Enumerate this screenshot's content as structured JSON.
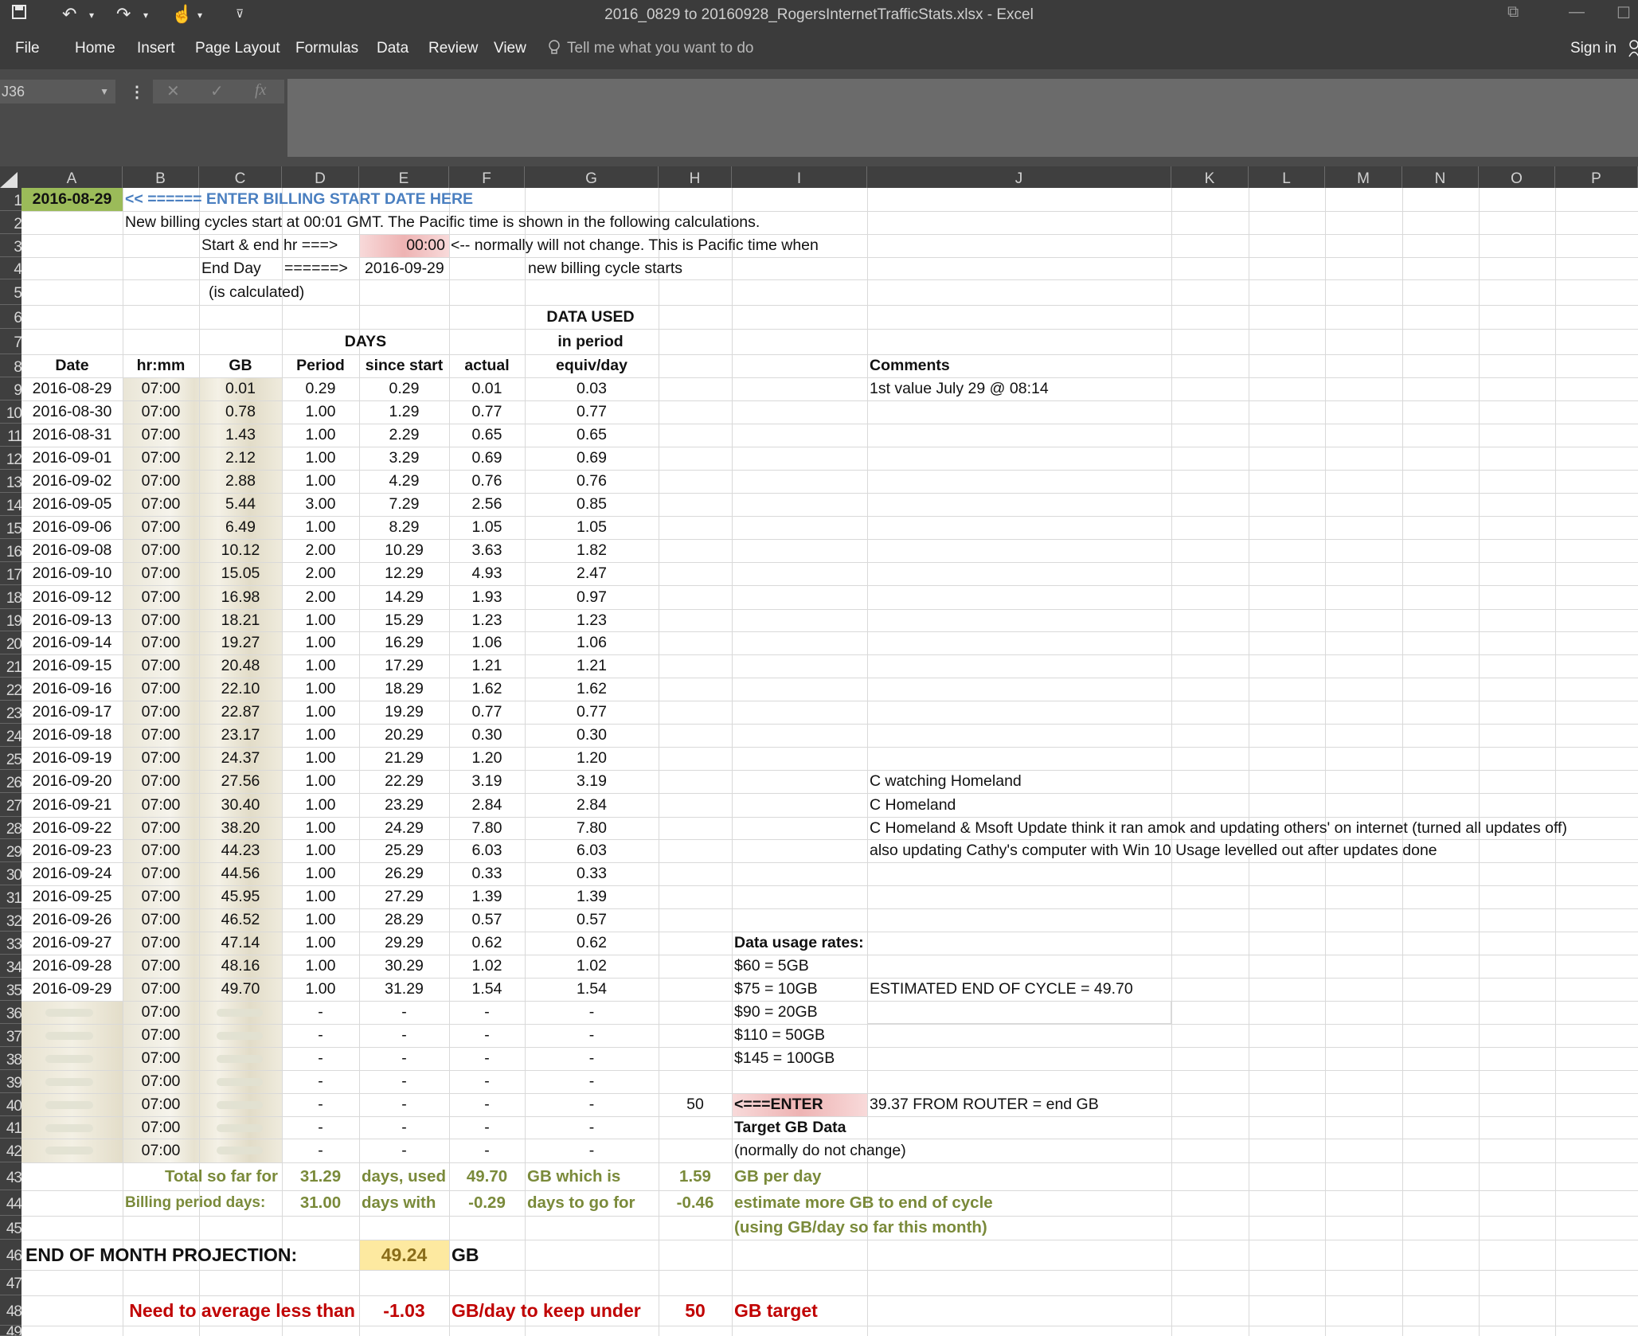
{
  "app": {
    "window_title": "2016_0829 to 20160928_RogersInternetTrafficStats.xlsx - Excel",
    "sign_in": "Sign in",
    "tabs": [
      "File",
      "Home",
      "Insert",
      "Page Layout",
      "Formulas",
      "Data",
      "Review",
      "View"
    ],
    "tell_me": "Tell me what you want to do"
  },
  "formula_bar": {
    "name_box": "J36",
    "fx_label": "fx",
    "cancel": "✕",
    "enter": "✓"
  },
  "columns": [
    "A",
    "B",
    "C",
    "D",
    "E",
    "F",
    "G",
    "H",
    "I",
    "J",
    "K",
    "L",
    "M",
    "N",
    "O",
    "P"
  ],
  "rows": [
    "1",
    "2",
    "3",
    "4",
    "5",
    "6",
    "7",
    "8",
    "9",
    "10",
    "11",
    "12",
    "13",
    "14",
    "15",
    "16",
    "17",
    "18",
    "19",
    "20",
    "21",
    "22",
    "23",
    "24",
    "25",
    "26",
    "27",
    "28",
    "29",
    "30",
    "31",
    "32",
    "33",
    "34",
    "35",
    "36",
    "37",
    "38",
    "39",
    "40",
    "41",
    "42",
    "43",
    "44",
    "45",
    "46",
    "47",
    "48",
    "49"
  ],
  "header_block": {
    "start_date": "2016-08-29",
    "enter_note": "<< ====== ENTER BILLING START DATE HERE",
    "cycle_note": "New billing cycles start at 00:01 GMT.  The Pacific time is shown in the following calculations.",
    "start_end_label": "Start & end hr ===>",
    "start_end_value": "00:00",
    "start_end_note": "<-- normally will not change. This is Pacific time when",
    "end_day_label": "End Day",
    "end_day_arrow": "======>",
    "end_day_value": "2016-09-29",
    "new_cycle_note": "new billing cycle starts",
    "calculated_note": "(is calculated)",
    "data_used": "DATA USED",
    "days": "DAYS",
    "in_period": "in period"
  },
  "table_headers": {
    "date": "Date",
    "hrmm": "hr:mm",
    "gb": "GB",
    "period": "Period",
    "since_start": "since start",
    "actual": "actual",
    "equiv": "equiv/day",
    "comments": "Comments"
  },
  "data_rows": [
    [
      "2016-08-29",
      "07:00",
      "0.01",
      "0.29",
      "0.29",
      "0.01",
      "0.03"
    ],
    [
      "2016-08-30",
      "07:00",
      "0.78",
      "1.00",
      "1.29",
      "0.77",
      "0.77"
    ],
    [
      "2016-08-31",
      "07:00",
      "1.43",
      "1.00",
      "2.29",
      "0.65",
      "0.65"
    ],
    [
      "2016-09-01",
      "07:00",
      "2.12",
      "1.00",
      "3.29",
      "0.69",
      "0.69"
    ],
    [
      "2016-09-02",
      "07:00",
      "2.88",
      "1.00",
      "4.29",
      "0.76",
      "0.76"
    ],
    [
      "2016-09-05",
      "07:00",
      "5.44",
      "3.00",
      "7.29",
      "2.56",
      "0.85"
    ],
    [
      "2016-09-06",
      "07:00",
      "6.49",
      "1.00",
      "8.29",
      "1.05",
      "1.05"
    ],
    [
      "2016-09-08",
      "07:00",
      "10.12",
      "2.00",
      "10.29",
      "3.63",
      "1.82"
    ],
    [
      "2016-09-10",
      "07:00",
      "15.05",
      "2.00",
      "12.29",
      "4.93",
      "2.47"
    ],
    [
      "2016-09-12",
      "07:00",
      "16.98",
      "2.00",
      "14.29",
      "1.93",
      "0.97"
    ],
    [
      "2016-09-13",
      "07:00",
      "18.21",
      "1.00",
      "15.29",
      "1.23",
      "1.23"
    ],
    [
      "2016-09-14",
      "07:00",
      "19.27",
      "1.00",
      "16.29",
      "1.06",
      "1.06"
    ],
    [
      "2016-09-15",
      "07:00",
      "20.48",
      "1.00",
      "17.29",
      "1.21",
      "1.21"
    ],
    [
      "2016-09-16",
      "07:00",
      "22.10",
      "1.00",
      "18.29",
      "1.62",
      "1.62"
    ],
    [
      "2016-09-17",
      "07:00",
      "22.87",
      "1.00",
      "19.29",
      "0.77",
      "0.77"
    ],
    [
      "2016-09-18",
      "07:00",
      "23.17",
      "1.00",
      "20.29",
      "0.30",
      "0.30"
    ],
    [
      "2016-09-19",
      "07:00",
      "24.37",
      "1.00",
      "21.29",
      "1.20",
      "1.20"
    ],
    [
      "2016-09-20",
      "07:00",
      "27.56",
      "1.00",
      "22.29",
      "3.19",
      "3.19"
    ],
    [
      "2016-09-21",
      "07:00",
      "30.40",
      "1.00",
      "23.29",
      "2.84",
      "2.84"
    ],
    [
      "2016-09-22",
      "07:00",
      "38.20",
      "1.00",
      "24.29",
      "7.80",
      "7.80"
    ],
    [
      "2016-09-23",
      "07:00",
      "44.23",
      "1.00",
      "25.29",
      "6.03",
      "6.03"
    ],
    [
      "2016-09-24",
      "07:00",
      "44.56",
      "1.00",
      "26.29",
      "0.33",
      "0.33"
    ],
    [
      "2016-09-25",
      "07:00",
      "45.95",
      "1.00",
      "27.29",
      "1.39",
      "1.39"
    ],
    [
      "2016-09-26",
      "07:00",
      "46.52",
      "1.00",
      "28.29",
      "0.57",
      "0.57"
    ],
    [
      "2016-09-27",
      "07:00",
      "47.14",
      "1.00",
      "29.29",
      "0.62",
      "0.62"
    ],
    [
      "2016-09-28",
      "07:00",
      "48.16",
      "1.00",
      "30.29",
      "1.02",
      "1.02"
    ],
    [
      "2016-09-29",
      "07:00",
      "49.70",
      "1.00",
      "31.29",
      "1.54",
      "1.54"
    ],
    [
      "",
      "07:00",
      "",
      "-",
      "-",
      "-",
      "-"
    ],
    [
      "",
      "07:00",
      "",
      "-",
      "-",
      "-",
      "-"
    ],
    [
      "",
      "07:00",
      "",
      "-",
      "-",
      "-",
      "-"
    ],
    [
      "",
      "07:00",
      "",
      "-",
      "-",
      "-",
      "-"
    ],
    [
      "",
      "07:00",
      "",
      "-",
      "-",
      "-",
      "-"
    ],
    [
      "",
      "07:00",
      "",
      "-",
      "-",
      "-",
      "-"
    ],
    [
      "",
      "07:00",
      "",
      "-",
      "-",
      "-",
      "-"
    ]
  ],
  "comments": [
    {
      "row": 9,
      "text": "1st value July 29 @ 08:14"
    },
    {
      "row": 26,
      "text": "C watching Homeland"
    },
    {
      "row": 27,
      "text": "C Homeland"
    },
    {
      "row": 28,
      "text": "C Homeland & Msoft Update think it ran amok and updating others' on internet (turned all updates off)"
    },
    {
      "row": 29,
      "text": "also updating Cathy's computer with Win 10 Usage levelled out after updates done"
    },
    {
      "row": 35,
      "text": "ESTIMATED END OF CYCLE = 49.70"
    },
    {
      "row": 40,
      "text": "39.37 FROM ROUTER = end GB"
    }
  ],
  "rates": {
    "title": "Data usage rates:",
    "items": [
      "$60 = 5GB",
      "$75 = 10GB",
      "$90 = 20GB",
      "$110 = 50GB",
      "$145 = 100GB"
    ],
    "target_value": "50",
    "enter_label": "<===ENTER",
    "target_label": "Target GB Data",
    "normally": "(normally do not change)"
  },
  "summary": {
    "total_label": "Total so far for",
    "total_days": "31.29",
    "days_used": "days, used",
    "total_gb": "49.70",
    "gb_which_is": "GB   which is",
    "gb_per_day_value": "1.59",
    "gb_per_day": "GB per day",
    "billing_label": "Billing period days:",
    "billing_days": "31.00",
    "days_with": "days with",
    "days_to_go_value": "-0.29",
    "days_to_go": "days to go for",
    "more_gb_value": "-0.46",
    "more_gb_label": "estimate more GB to end of cycle",
    "using_note": "(using GB/day so far this month)",
    "projection_label": "END OF MONTH PROJECTION:",
    "projection_value": "49.24",
    "projection_unit": "GB",
    "need_label": "Need to average less than",
    "need_value": "-1.03",
    "need_unit": "GB/day to keep under",
    "need_target": "50",
    "gb_target": "GB target"
  },
  "colors": {
    "title_bar": "#3b3b3b",
    "date_fill": "#9bbb59",
    "pink_fill": "#f2c4c4",
    "projection_fill": "#fde9a0",
    "olive_text": "#7a8a3a",
    "red_text": "#c00000",
    "blue_text": "#4a7fc0"
  },
  "icons": [
    "save-icon",
    "undo-icon",
    "redo-icon",
    "touch-mode-icon",
    "customize-qat-icon",
    "lightbulb-icon",
    "person-icon",
    "restore-icon",
    "minimize-icon",
    "maximize-icon"
  ]
}
